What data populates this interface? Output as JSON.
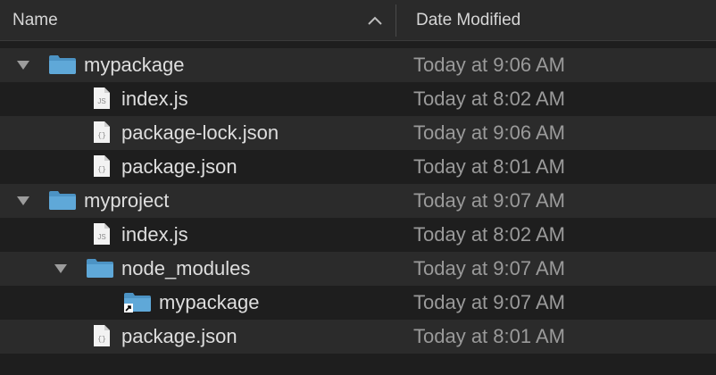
{
  "header": {
    "name_label": "Name",
    "date_label": "Date Modified",
    "sort_icon": "chevron-up-icon"
  },
  "rows": [
    {
      "name": "mypackage",
      "date": "Today at 9:06 AM",
      "kind": "folder",
      "expanded": true
    },
    {
      "name": "index.js",
      "date": "Today at 8:02 AM",
      "kind": "js-file"
    },
    {
      "name": "package-lock.json",
      "date": "Today at 9:06 AM",
      "kind": "json-file"
    },
    {
      "name": "package.json",
      "date": "Today at 8:01 AM",
      "kind": "json-file"
    },
    {
      "name": "myproject",
      "date": "Today at 9:07 AM",
      "kind": "folder",
      "expanded": true
    },
    {
      "name": "index.js",
      "date": "Today at 8:02 AM",
      "kind": "js-file"
    },
    {
      "name": "node_modules",
      "date": "Today at 9:07 AM",
      "kind": "folder",
      "expanded": true
    },
    {
      "name": "mypackage",
      "date": "Today at 9:07 AM",
      "kind": "folder-alias"
    },
    {
      "name": "package.json",
      "date": "Today at 8:01 AM",
      "kind": "json-file"
    }
  ],
  "colors": {
    "folder": "#5fa8d8",
    "folder_tab": "#4c93c4",
    "text": "#dedede",
    "date_text": "#9a9a9a",
    "row_alt": "#2b2b2b",
    "background": "#1e1e1e"
  }
}
